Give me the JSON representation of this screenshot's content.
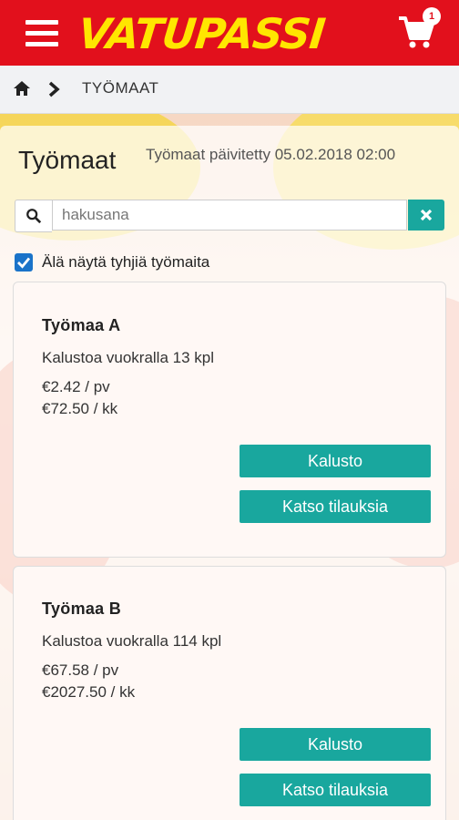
{
  "app": {
    "logo_text": "VATUPASSI",
    "cart_count": "1"
  },
  "colors": {
    "brand_red": "#e2101c",
    "brand_yellow": "#ffe600",
    "teal": "#19a79e",
    "checkbox_blue": "#1a73c9"
  },
  "icons": [
    "menu-icon",
    "cart-icon",
    "home-icon",
    "chevron-right-icon",
    "search-icon",
    "close-icon",
    "checkbox-checked-icon"
  ],
  "breadcrumb": {
    "current": "TYÖMAAT"
  },
  "page": {
    "title": "Työmaat",
    "updated": "Työmaat päivitetty 05.02.2018 02:00"
  },
  "search": {
    "placeholder": "hakusana",
    "value": ""
  },
  "filter": {
    "label": "Älä näytä tyhjiä työmaita",
    "checked": true
  },
  "sites": [
    {
      "name": "Työmaa A",
      "rental": "Kalustoa vuokralla 13 kpl",
      "per_day": "€2.42 / pv",
      "per_month": "€72.50 / kk",
      "btn_equipment": "Kalusto",
      "btn_orders": "Katso tilauksia"
    },
    {
      "name": "Työmaa B",
      "rental": "Kalustoa vuokralla 114 kpl",
      "per_day": "€67.58 / pv",
      "per_month": "€2027.50 / kk",
      "btn_equipment": "Kalusto",
      "btn_orders": "Katso tilauksia"
    }
  ]
}
